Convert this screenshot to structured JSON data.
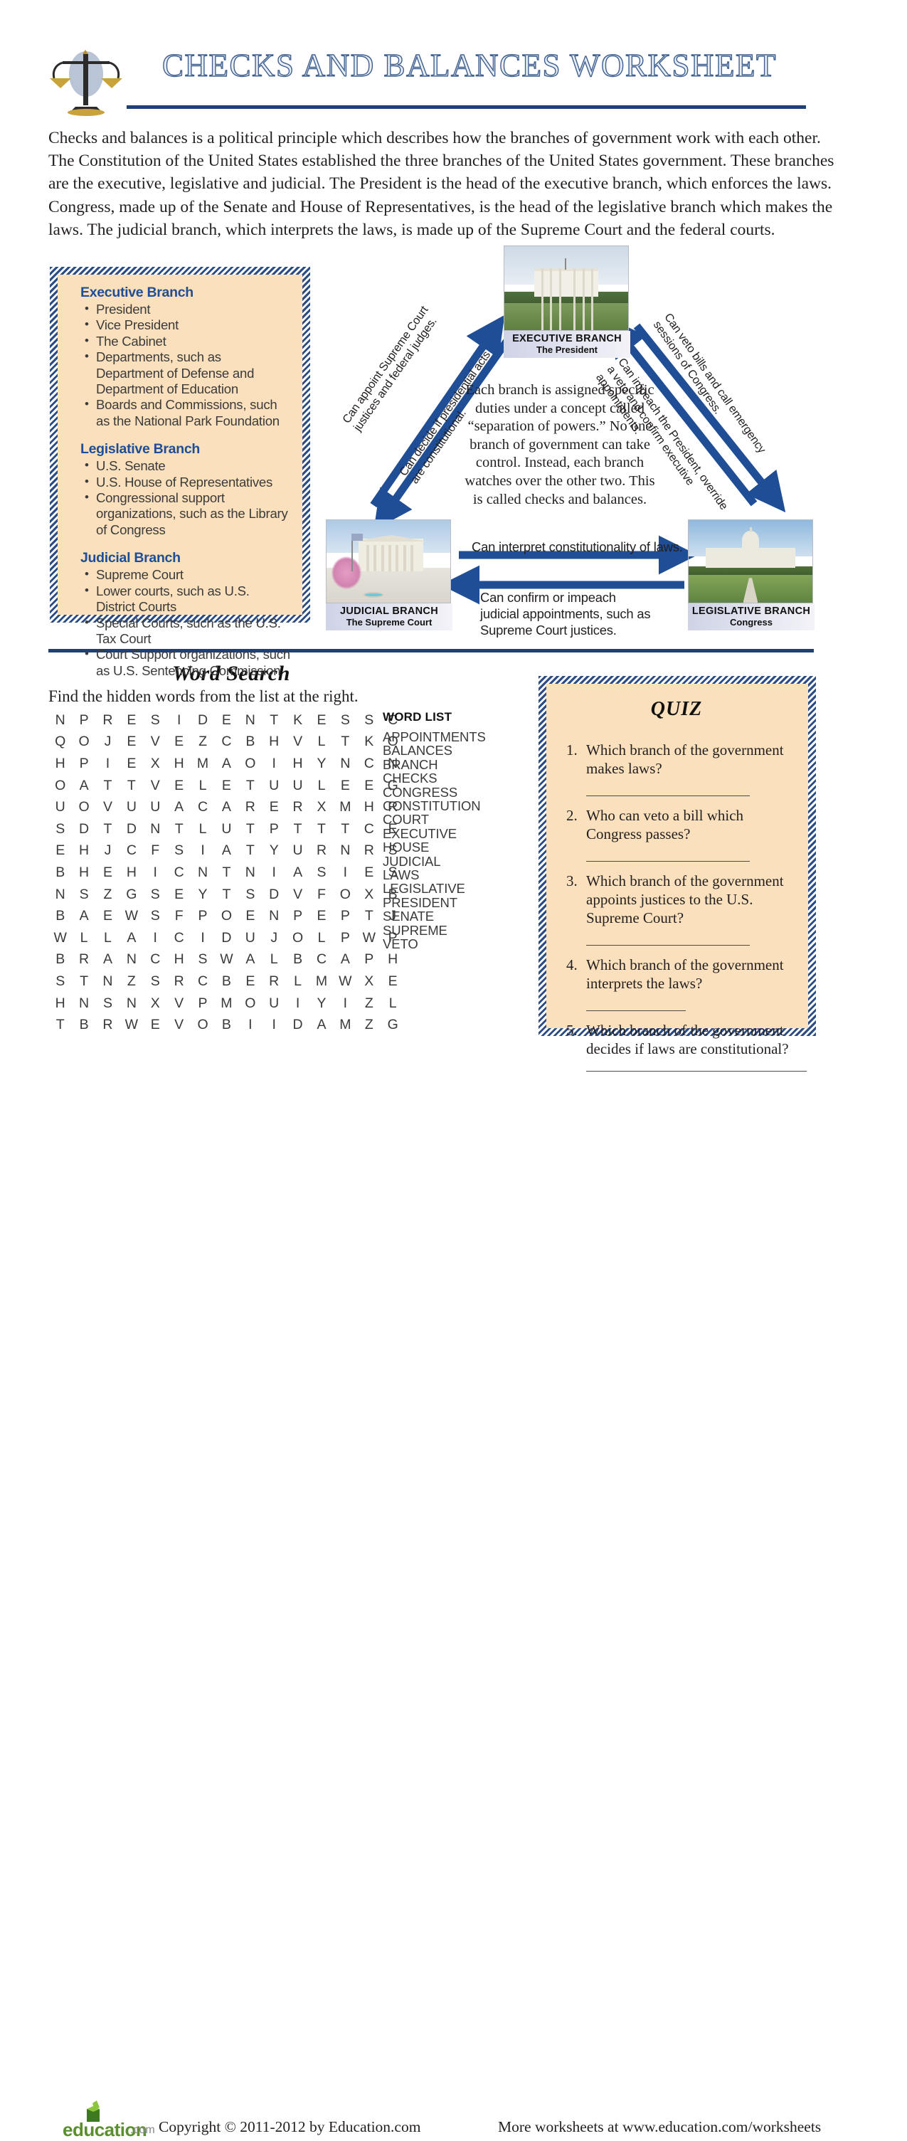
{
  "header": {
    "title": "CHECKS AND BALANCES WORKSHEET",
    "icon": "scales-of-justice-icon"
  },
  "intro": {
    "paragraph": "Checks and balances is a political principle which describes how the branches of government work with each other. The Constitution of the United States established the three branches of the United States government. These branches are the executive, legislative and judicial. The President is the head of the executive branch, which enforces the laws. Congress, made up of the Senate and House of Representatives, is the head of the legislative branch which makes the laws. The judicial branch, which interprets the laws, is made up of the Supreme Court and the federal courts."
  },
  "branch_box": {
    "accent_color": "#1f4e96",
    "background_color": "#fae0bc",
    "sections": [
      {
        "heading": "Executive Branch",
        "items": [
          "President",
          "Vice President",
          "The Cabinet",
          "Departments, such as Department of Defense and Department of Education",
          "Boards and Commissions, such as the National Park Foundation"
        ]
      },
      {
        "heading": "Legislative Branch",
        "items": [
          "U.S. Senate",
          "U.S. House of Representatives",
          "Congressional support organizations, such as the Library of Congress"
        ]
      },
      {
        "heading": "Judicial Branch",
        "items": [
          "Supreme Court",
          "Lower courts, such as U.S. District Courts",
          "Special Courts, such as the U.S. Tax Court",
          "Court Support organizations, such as U.S. Sentencing Commission"
        ]
      }
    ]
  },
  "diagram": {
    "arrow_color": "#1f4e96",
    "center_text": "Each branch is assigned specific duties under a concept called “separation of powers.” No one branch of government can take control. Instead, each branch watches over the other two. This is called checks and balances.",
    "nodes": [
      {
        "id": "executive",
        "caption_line1": "EXECUTIVE BRANCH",
        "caption_line2": "The President",
        "image": "white-house-photo"
      },
      {
        "id": "judicial",
        "caption_line1": "JUDICIAL BRANCH",
        "caption_line2": "The Supreme Court",
        "image": "supreme-court-photo"
      },
      {
        "id": "legislative",
        "caption_line1": "LEGISLATIVE BRANCH",
        "caption_line2": "Congress",
        "image": "us-capitol-photo"
      }
    ],
    "arrow_labels": {
      "exec_to_judicial": "Can appoint Supreme Court justices and federal judges.",
      "judicial_to_exec": "Can decide if presidential acts are constitutional.",
      "legislative_to_exec": "Can impeach the President, override a veto and confirm executive appointments.",
      "exec_to_legislative": "Can veto bills and call emergency sessions of Congress.",
      "judicial_to_legislative": "Can interpret constitutionality of laws.",
      "legislative_to_judicial": "Can confirm or impeach judicial appointments, such as Supreme Court justices."
    }
  },
  "word_search": {
    "title": "Word Search",
    "instructions": "Find the hidden words from the list at the right.",
    "word_list_title": "WORD LIST",
    "grid": [
      [
        "N",
        "P",
        "R",
        "E",
        "S",
        "I",
        "D",
        "E",
        "N",
        "T",
        "K",
        "E",
        "S",
        "S",
        "C"
      ],
      [
        "Q",
        "O",
        "J",
        "E",
        "V",
        "E",
        "Z",
        "C",
        "B",
        "H",
        "V",
        "L",
        "T",
        "K",
        "O"
      ],
      [
        "H",
        "P",
        "I",
        "E",
        "X",
        "H",
        "M",
        "A",
        "O",
        "I",
        "H",
        "Y",
        "N",
        "C",
        "N"
      ],
      [
        "O",
        "A",
        "T",
        "T",
        "V",
        "E",
        "L",
        "E",
        "T",
        "U",
        "U",
        "L",
        "E",
        "E",
        "G"
      ],
      [
        "U",
        "O",
        "V",
        "U",
        "U",
        "A",
        "C",
        "A",
        "R",
        "E",
        "R",
        "X",
        "M",
        "H",
        "R"
      ],
      [
        "S",
        "D",
        "T",
        "D",
        "N",
        "T",
        "L",
        "U",
        "T",
        "P",
        "T",
        "T",
        "T",
        "C",
        "E"
      ],
      [
        "E",
        "H",
        "J",
        "C",
        "F",
        "S",
        "I",
        "A",
        "T",
        "Y",
        "U",
        "R",
        "N",
        "R",
        "S"
      ],
      [
        "B",
        "H",
        "E",
        "H",
        "I",
        "C",
        "N",
        "T",
        "N",
        "I",
        "A",
        "S",
        "I",
        "E",
        "S"
      ],
      [
        "N",
        "S",
        "Z",
        "G",
        "S",
        "E",
        "Y",
        "T",
        "S",
        "D",
        "V",
        "F",
        "O",
        "X",
        "B"
      ],
      [
        "B",
        "A",
        "E",
        "W",
        "S",
        "F",
        "P",
        "O",
        "E",
        "N",
        "P",
        "E",
        "P",
        "T",
        "J"
      ],
      [
        "W",
        "L",
        "L",
        "A",
        "I",
        "C",
        "I",
        "D",
        "U",
        "J",
        "O",
        "L",
        "P",
        "W",
        "P"
      ],
      [
        "B",
        "R",
        "A",
        "N",
        "C",
        "H",
        "S",
        "W",
        "A",
        "L",
        "B",
        "C",
        "A",
        "P",
        "H"
      ],
      [
        "S",
        "T",
        "N",
        "Z",
        "S",
        "R",
        "C",
        "B",
        "E",
        "R",
        "L",
        "M",
        "W",
        "X",
        "E"
      ],
      [
        "H",
        "N",
        "S",
        "N",
        "X",
        "V",
        "P",
        "M",
        "O",
        "U",
        "I",
        "Y",
        "I",
        "Z",
        "L"
      ],
      [
        "T",
        "B",
        "R",
        "W",
        "E",
        "V",
        "O",
        "B",
        "I",
        "I",
        "D",
        "A",
        "M",
        "Z",
        "G"
      ]
    ],
    "words": [
      "APPOINTMENTS",
      "BALANCES",
      "BRANCH",
      "CHECKS",
      "CONGRESS",
      "CONSTITUTION",
      "COURT",
      "EXECUTIVE",
      "HOUSE",
      "JUDICIAL",
      "LAWS",
      "LEGISLATIVE",
      "PRESIDENT",
      "SENATE",
      "SUPREME",
      "VETO"
    ]
  },
  "quiz": {
    "title": "QUIZ",
    "questions": [
      "Which branch of the government makes laws?",
      "Who can veto a bill which Congress passes?",
      "Which branch of the government appoints justices to the U.S. Supreme Court?",
      "Which branch of the government interprets the laws?",
      "Which branch of the government decides if laws are constitutional?"
    ]
  },
  "footer": {
    "logo_word": "education",
    "logo_tld": ".com",
    "copyright": "Copyright © 2011-2012 by Education.com",
    "more": "More worksheets at www.education.com/worksheets"
  }
}
